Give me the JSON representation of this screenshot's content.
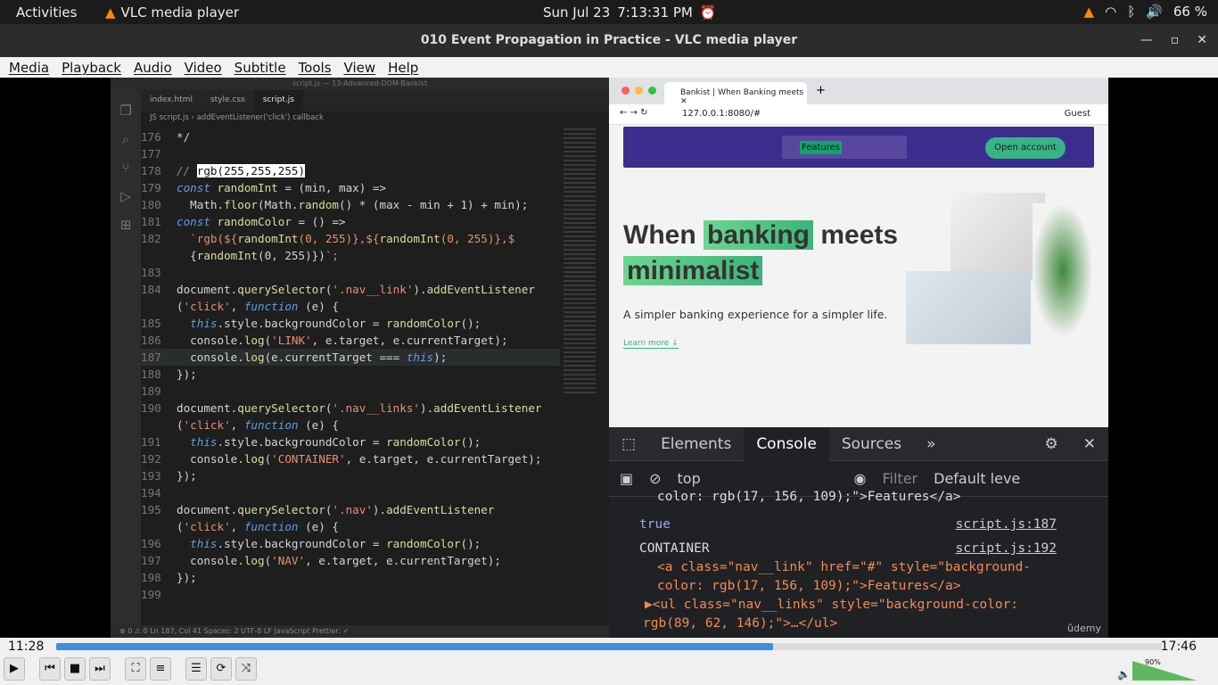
{
  "system": {
    "activities": "Activities",
    "app": "VLC media player",
    "date": "Sun Jul 23",
    "time": "7:13:31 PM",
    "battery": "66 %"
  },
  "window": {
    "title": "010 Event Propagation in Practice - VLC media player"
  },
  "menu": [
    "Media",
    "Playback",
    "Audio",
    "Video",
    "Subtitle",
    "Tools",
    "View",
    "Help"
  ],
  "vscode": {
    "title": "script.js — 13-Advanced-DOM-Bankist",
    "tabs": [
      "index.html",
      "style.css",
      "script.js"
    ],
    "breadcrumb": "JS script.js › addEventListener('click') callback",
    "status": "⊗ 0 ⚠ 0     Ln 187, Col 41   Spaces: 2   UTF-8   LF   JavaScript   Prettier: ✓"
  },
  "code_lines": [
    [
      "176",
      "*/"
    ],
    [
      "177",
      ""
    ],
    [
      "178",
      "// rgb(255,255,255)"
    ],
    [
      "179",
      "const randomInt = (min, max) =>"
    ],
    [
      "180",
      "  Math.floor(Math.random() * (max - min + 1) + min);"
    ],
    [
      "181",
      "const randomColor = () =>"
    ],
    [
      "182",
      "  `rgb(${randomInt(0, 255)},${randomInt(0, 255)},$"
    ],
    [
      "",
      "  {randomInt(0, 255)})`;"
    ],
    [
      "183",
      ""
    ],
    [
      "184",
      "document.querySelector('.nav__link').addEventListener"
    ],
    [
      "",
      "('click', function (e) {"
    ],
    [
      "185",
      "  this.style.backgroundColor = randomColor();"
    ],
    [
      "186",
      "  console.log('LINK', e.target, e.currentTarget);"
    ],
    [
      "187",
      "  console.log(e.currentTarget === this);"
    ],
    [
      "188",
      "});"
    ],
    [
      "189",
      ""
    ],
    [
      "190",
      "document.querySelector('.nav__links').addEventListener"
    ],
    [
      "",
      "('click', function (e) {"
    ],
    [
      "191",
      "  this.style.backgroundColor = randomColor();"
    ],
    [
      "192",
      "  console.log('CONTAINER', e.target, e.currentTarget);"
    ],
    [
      "193",
      "});"
    ],
    [
      "194",
      ""
    ],
    [
      "195",
      "document.querySelector('.nav').addEventListener"
    ],
    [
      "",
      "('click', function (e) {"
    ],
    [
      "196",
      "  this.style.backgroundColor = randomColor();"
    ],
    [
      "197",
      "  console.log('NAV', e.target, e.currentTarget);"
    ],
    [
      "198",
      "});"
    ],
    [
      "199",
      ""
    ]
  ],
  "browser": {
    "tab": "Bankist | When Banking meets",
    "url": "127.0.0.1:8080/#",
    "guest": "Guest"
  },
  "site": {
    "nav_feature": "Features",
    "open": "Open account",
    "h1a": "When ",
    "h1b": "banking",
    "h1c": " meets",
    "h1d": "minimalist",
    "sub": "A simpler banking experience for a simpler life.",
    "more": "Learn more ↓"
  },
  "devtools": {
    "tabs": [
      "Elements",
      "Console",
      "Sources"
    ],
    "context": "top",
    "filter": "Filter",
    "levels": "Default leve"
  },
  "console": {
    "l1": "color: rgb(17, 156, 109);\">Features</a>",
    "l2": "true",
    "src2": "script.js:187",
    "l3": "CONTAINER",
    "src3": "script.js:192",
    "l4": "<a class=\"nav__link\" href=\"#\" style=\"background-",
    "l5": "color: rgb(17, 156, 109);\">Features</a>",
    "l6": "▶<ul class=\"nav__links\" style=\"background-color:",
    "l7": "rgb(89, 62, 146);\">…</ul>",
    "brand": "ûdemy"
  },
  "player": {
    "elapsed": "11:28",
    "total": "17:46",
    "progress": 0.648,
    "volume": "90%"
  }
}
